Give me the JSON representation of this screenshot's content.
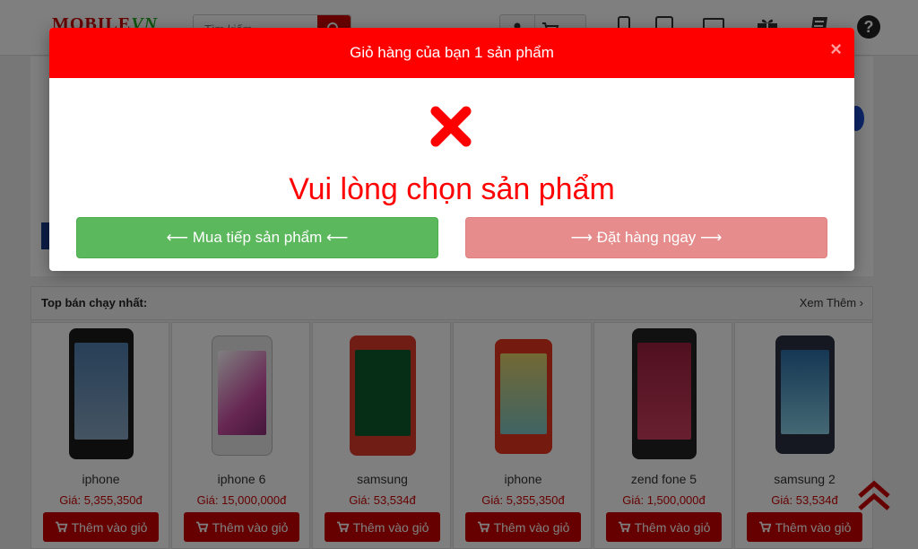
{
  "header": {
    "logo_part1": "MOBILE",
    "logo_part2": "VN",
    "search_placeholder": "Tìm kiếm",
    "nav_icons": [
      "phone-icon",
      "tablet-icon",
      "laptop-icon",
      "gift-icon",
      "notebook-icon",
      "help-icon"
    ]
  },
  "section": {
    "title": "Top bán chạy nhất:",
    "see_more": "Xem Thêm ›"
  },
  "products": [
    {
      "name": "iphone",
      "price": "Giá: 5,355,350đ",
      "cta": "Thêm vào giỏ",
      "screen": "#6b8fb3"
    },
    {
      "name": "iphone 6",
      "price": "Giá: 15,000,000đ",
      "cta": "Thêm vào giỏ",
      "screen": "#c04b9c"
    },
    {
      "name": "samsung",
      "price": "Giá: 53,534đ",
      "cta": "Thêm vào giỏ",
      "screen": "#2a8a3a"
    },
    {
      "name": "iphone",
      "price": "Giá: 5,355,350đ",
      "cta": "Thêm vào giỏ",
      "screen": "#d8c45a"
    },
    {
      "name": "zend fone 5",
      "price": "Giá: 1,500,000đ",
      "cta": "Thêm vào giỏ",
      "screen": "#b0304a"
    },
    {
      "name": "samsung 2",
      "price": "Giá: 53,534đ",
      "cta": "Thêm vào giỏ",
      "screen": "#4a8fc0"
    }
  ],
  "modal": {
    "title": "Giỏ hàng của bạn 1 sản phẩm",
    "close": "×",
    "message": "Vui lòng chọn sản phẩm",
    "continue_label": "⟵ Mua tiếp sản phẩm ⟵",
    "order_label": "⟶ Đặt hàng ngay ⟶"
  },
  "colors": {
    "brand_red": "#ff0000",
    "price_red": "#cc0000",
    "continue_green": "#5cb85c",
    "order_disabled": "#e68c8c"
  }
}
